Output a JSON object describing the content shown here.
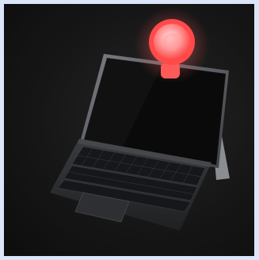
{
  "image": {
    "subject": "tablet-with-keyboard-and-clip-on-ring-light",
    "colors": {
      "frame": "#dbe6f8",
      "background": "#161616",
      "ring_light": "#ff4a4a",
      "ring_light_glow": "#ff6a6a",
      "tablet_body": "#5c5f63",
      "screen": "#0a0a0a",
      "keyboard": "#2a2b2d"
    }
  }
}
